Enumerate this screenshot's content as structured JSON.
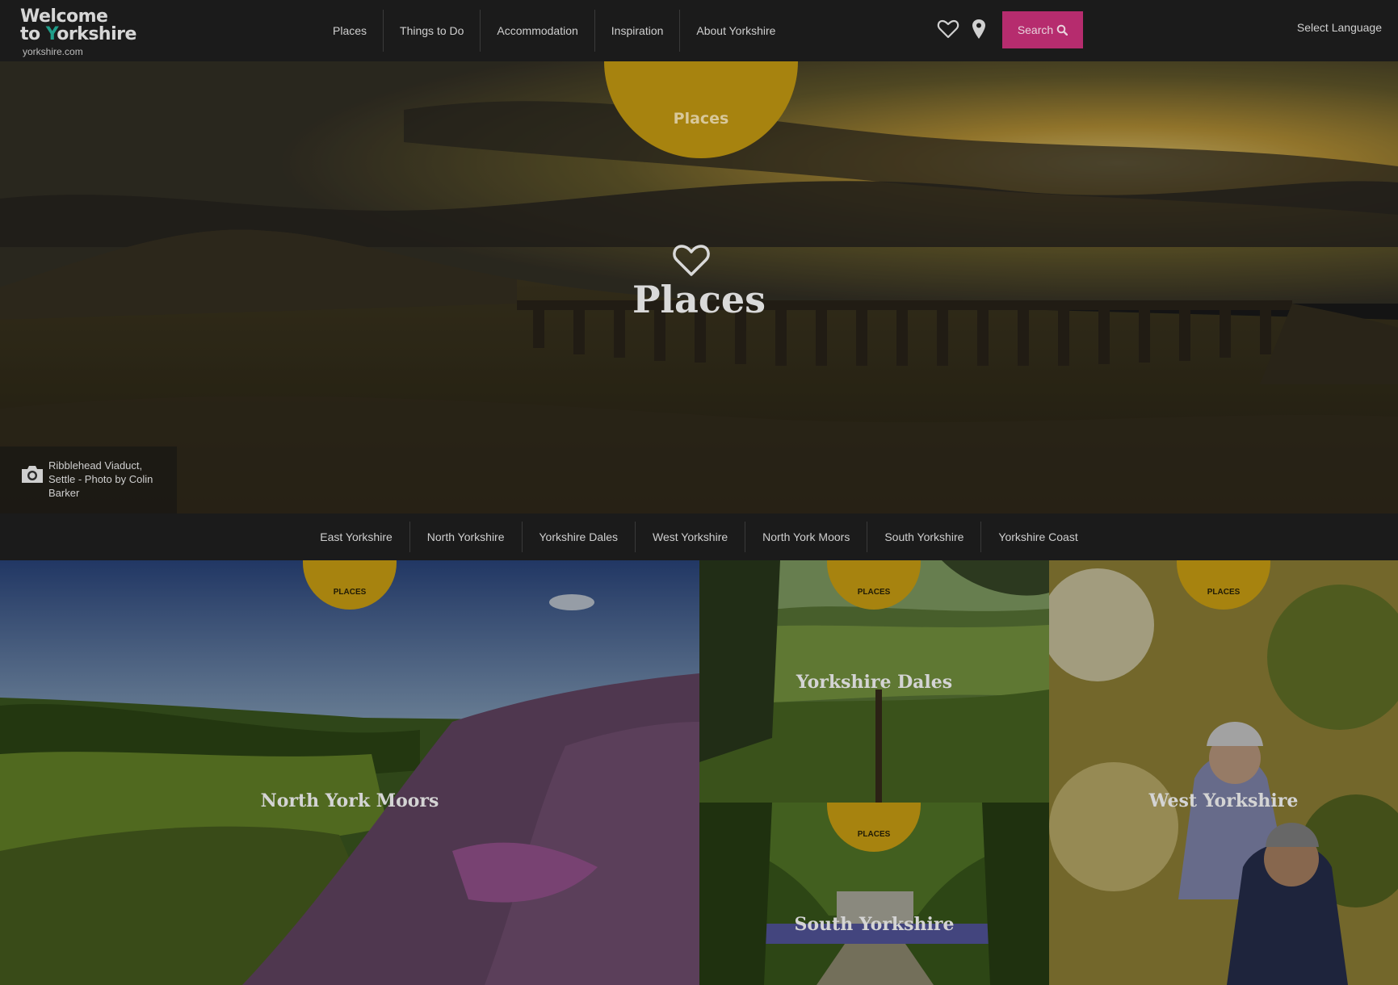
{
  "logo": {
    "line1": "Welcome",
    "line2_prefix": "to ",
    "line2_y": "Y",
    "line2_rest": "orkshire",
    "url": "yorkshire.com"
  },
  "nav": {
    "items": [
      "Places",
      "Things to Do",
      "Accommodation",
      "Inspiration",
      "About Yorkshire"
    ]
  },
  "header": {
    "favourites_icon": "heart-icon",
    "location_icon": "map-pin-icon",
    "search_label": "Search",
    "search_icon": "search-icon",
    "language_label": "Select Language"
  },
  "hero": {
    "tab_label": "Places",
    "title": "Places",
    "icon": "heart-icon",
    "photo_credit": "Ribblehead Viaduct, Settle - Photo by Colin Barker",
    "credit_icon": "camera-icon"
  },
  "subnav": {
    "items": [
      "East Yorkshire",
      "North Yorkshire",
      "Yorkshire Dales",
      "West Yorkshire",
      "North York Moors",
      "South Yorkshire",
      "Yorkshire Coast"
    ]
  },
  "tiles": [
    {
      "badge": "PLACES",
      "title": "North York Moors"
    },
    {
      "badge": "PLACES",
      "title": "Yorkshire Dales"
    },
    {
      "badge": "PLACES",
      "title": "West Yorkshire"
    },
    {
      "badge": "PLACES",
      "title": "South Yorkshire"
    }
  ],
  "colors": {
    "accent_gold": "#a7830f",
    "search_pink": "#b62c6e",
    "logo_teal": "#1f9e8a"
  }
}
